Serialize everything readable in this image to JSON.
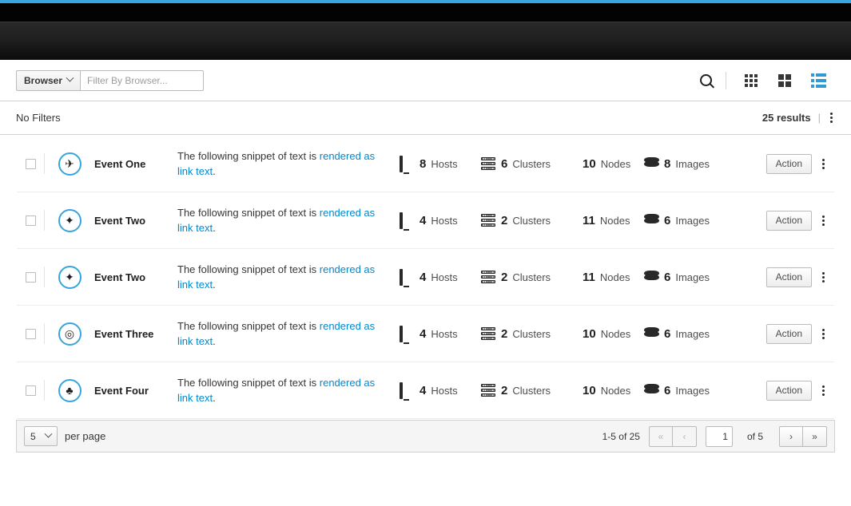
{
  "header": {
    "accent_color": "#39a5dc",
    "navbar_color": "#030303"
  },
  "toolbar": {
    "filter_category_label": "Browser",
    "filter_placeholder": "Filter By Browser...",
    "filter_value": "",
    "search_icon": "search-icon",
    "views": [
      {
        "name": "card-view-small",
        "icon": "grid-small-icon",
        "active": false
      },
      {
        "name": "card-view-large",
        "icon": "grid-large-icon",
        "active": false
      },
      {
        "name": "list-view",
        "icon": "list-icon",
        "active": true
      }
    ],
    "active_view_color": "#2e9bd6"
  },
  "filterbar": {
    "no_filters_label": "No Filters",
    "results_count": "25 results",
    "separator": "|",
    "kebab_icon": "kebab-menu-icon"
  },
  "list": {
    "link_color": "#0088ce",
    "description_prefix": "The following snippet of text is ",
    "description_link": "rendered as link text",
    "description_suffix": ".",
    "action_label": "Action",
    "metric_labels": {
      "hosts": "Hosts",
      "clusters": "Clusters",
      "nodes": "Nodes",
      "images": "Images"
    },
    "rows": [
      {
        "title": "Event One",
        "icon": "airplane-icon",
        "glyph": "✈",
        "hosts": "8",
        "clusters": "6",
        "nodes": "10",
        "images": "8"
      },
      {
        "title": "Event Two",
        "icon": "magic-wand-icon",
        "glyph": "✦",
        "hosts": "4",
        "clusters": "2",
        "nodes": "11",
        "images": "6"
      },
      {
        "title": "Event Two",
        "icon": "magic-wand-icon",
        "glyph": "✦",
        "hosts": "4",
        "clusters": "2",
        "nodes": "11",
        "images": "6"
      },
      {
        "title": "Event Three",
        "icon": "gamepad-icon",
        "glyph": "◎",
        "hosts": "4",
        "clusters": "2",
        "nodes": "10",
        "images": "6"
      },
      {
        "title": "Event Four",
        "icon": "linux-penguin-icon",
        "glyph": "♣",
        "hosts": "4",
        "clusters": "2",
        "nodes": "10",
        "images": "6"
      }
    ]
  },
  "footer": {
    "per_page_value": "5",
    "per_page_label": "per page",
    "range_label": "1-5 of 25",
    "first_page_icon": "«",
    "prev_page_icon": "‹",
    "current_page": "1",
    "of_pages_label": "of 5",
    "next_page_icon": "›",
    "last_page_icon": "»"
  }
}
